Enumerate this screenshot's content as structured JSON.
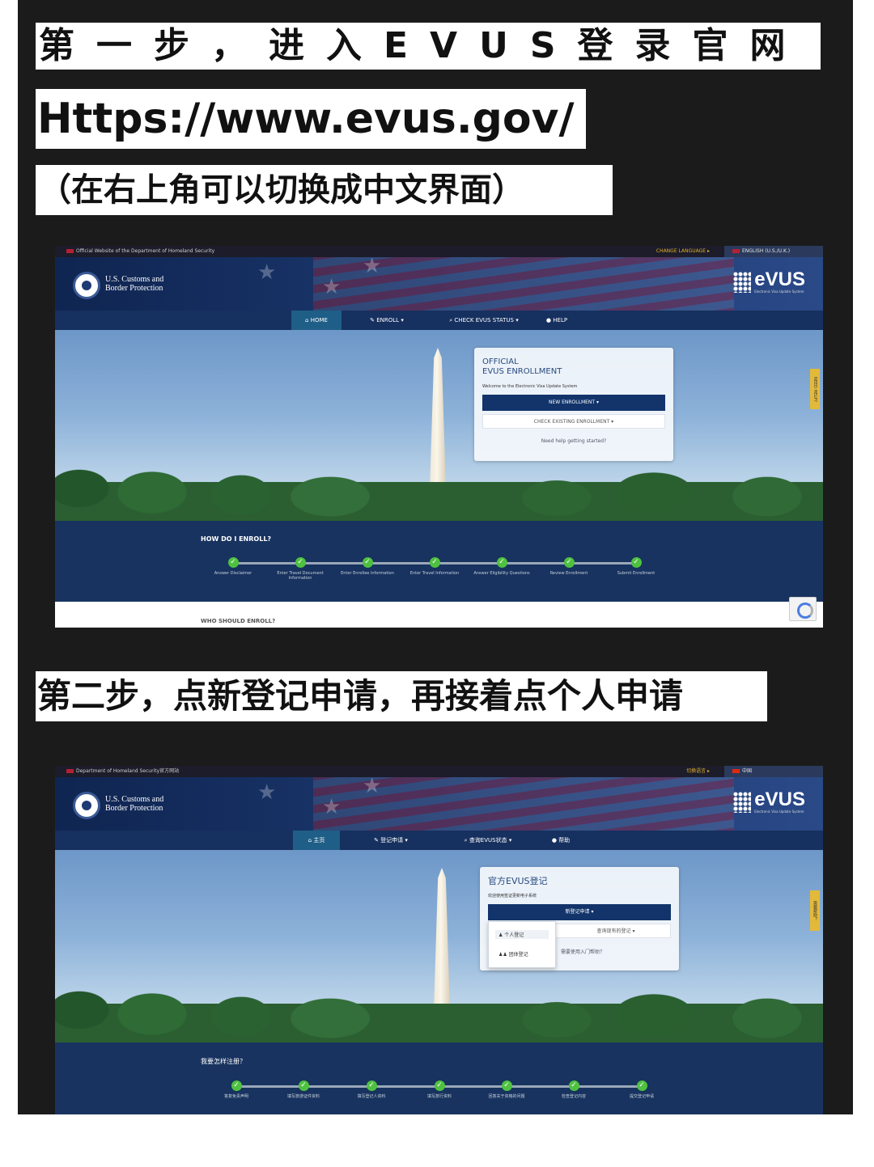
{
  "captions": {
    "step1": "第一步，进入EVUS登录官网",
    "url": "Https://www.evus.gov/",
    "note": "（在右上角可以切换成中文界面）",
    "step2": "第二步，点新登记申请，再接着点个人申请"
  },
  "shot1": {
    "topbar": {
      "official": "Official Website of the Department of Homeland Security",
      "change_language": "CHANGE LANGUAGE",
      "language": "ENGLISH (U.S./U.K.)"
    },
    "header": {
      "agency_line1": "U.S. Customs and",
      "agency_line2": "Border Protection",
      "logo": "eVUS",
      "logo_sub": "Electronic Visa Update System"
    },
    "nav": {
      "home": "HOME",
      "enroll": "ENROLL",
      "check": "CHECK EVUS STATUS",
      "help": "HELP"
    },
    "panel": {
      "title_line1": "OFFICIAL",
      "title_line2": "EVUS ENROLLMENT",
      "welcome": "Welcome to the Electronic Visa Update System",
      "new_enrollment": "NEW ENROLLMENT",
      "check_existing": "CHECK EXISTING ENROLLMENT",
      "help": "Need help getting started?"
    },
    "need_help": "NEED HELP?",
    "how_title": "HOW DO I ENROLL?",
    "steps": [
      "Answer Disclaimer",
      "Enter Travel Document Information",
      "Enter Enrollee Information",
      "Enter Travel Information",
      "Answer Eligibility Questions",
      "Review Enrollment",
      "Submit Enrollment"
    ],
    "who_title": "WHO SHOULD ENROLL?"
  },
  "shot2": {
    "topbar": {
      "official": "Department of Homeland Security官方网站",
      "change_language": "切换语言",
      "language": "中国"
    },
    "header": {
      "agency_line1": "U.S. Customs and",
      "agency_line2": "Border Protection",
      "logo": "eVUS",
      "logo_sub": "Electronic Visa Update System"
    },
    "nav": {
      "home": "主页",
      "enroll": "登记申请",
      "check": "查询EVUS状态",
      "help": "帮助"
    },
    "panel": {
      "title": "官方EVUS登记",
      "welcome": "欢迎使用签证更新电子系统",
      "new_enrollment": "新登记申请",
      "check_existing": "查询现有的登记",
      "help": "需要使用入门帮助？"
    },
    "dropdown": {
      "individual": "个人登记",
      "group": "团体登记"
    },
    "need_help": "需要帮助？",
    "how_title": "我要怎样注册？",
    "steps": [
      "答复免责声明",
      "填写旅游证件资料",
      "填写登记人资料",
      "填写旅行资料",
      "回答关于资格的问题",
      "检查登记内容",
      "提交登记申请"
    ]
  }
}
